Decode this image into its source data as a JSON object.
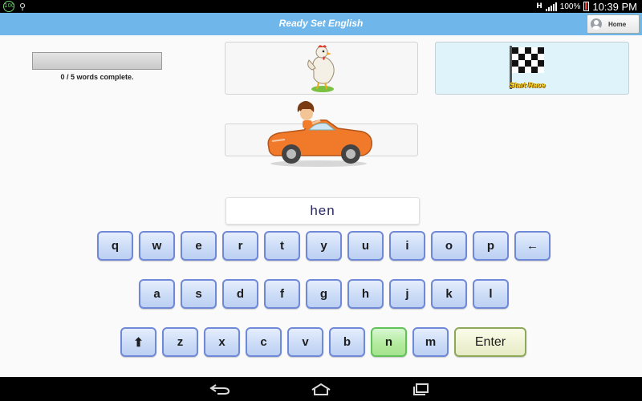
{
  "status_bar": {
    "battery_badge": "100",
    "signal_label": "H",
    "battery_percent": "100%",
    "battery_level": 1.0,
    "time": "10:39 PM"
  },
  "header": {
    "title": "Ready Set English",
    "home_label": "Home"
  },
  "progress": {
    "label": "0 / 5 words complete.",
    "fraction": 0
  },
  "finish_tile": {
    "label": "Start Race"
  },
  "answer": {
    "text": "hen"
  },
  "keyboard": {
    "row1": [
      "q",
      "w",
      "e",
      "r",
      "t",
      "y",
      "u",
      "i",
      "o",
      "p",
      "←"
    ],
    "row2": [
      "a",
      "s",
      "d",
      "f",
      "g",
      "h",
      "j",
      "k",
      "l"
    ],
    "row3": [
      "⬆",
      "z",
      "x",
      "c",
      "v",
      "b",
      "n",
      "m",
      "Enter"
    ],
    "highlighted_key": "n"
  },
  "colors": {
    "title_bar": "#6fb6ea",
    "key_border": "#6f88d8",
    "highlight_key": "#62c25a",
    "finish_tile_bg": "#dff3fb"
  },
  "icons": {
    "back": "back-arrow-icon",
    "home": "home-outline-icon",
    "recents": "recent-apps-icon"
  }
}
